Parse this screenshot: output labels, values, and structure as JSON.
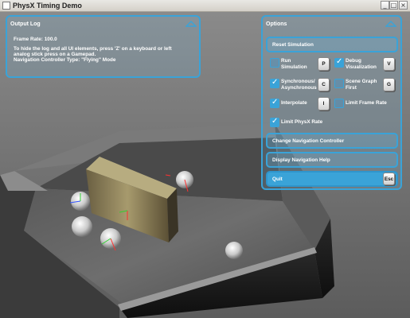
{
  "window": {
    "title": "PhysX Timing Demo",
    "min": "_",
    "max": "□",
    "close": "×"
  },
  "output_log": {
    "title": "Output Log",
    "lines": [
      "Frame Rate: 100.0",
      "To hide the log and all UI elements, press 'Z' on a keyboard or left",
      "analog stick press on a Gamepad.",
      "Navigation Controller Type: \"Flying\" Mode"
    ]
  },
  "options": {
    "title": "Options",
    "reset_label": "Reset Simulation",
    "checkboxes": [
      {
        "label": "Run Simulation",
        "checked": false,
        "key": "P"
      },
      {
        "label": "Debug Visualization",
        "checked": true,
        "key": "V"
      },
      {
        "label": "Synchronous/ Asynchronous",
        "checked": true,
        "key": "C"
      },
      {
        "label": "Scene Graph First",
        "checked": false,
        "key": "G"
      },
      {
        "label": "Interpolate",
        "checked": true,
        "key": "I"
      },
      {
        "label": "Limit Frame Rate",
        "checked": false,
        "key": ""
      },
      {
        "label": "Limit PhysX Rate",
        "checked": true,
        "key": ""
      }
    ],
    "change_nav_label": "Change Navigation Controller",
    "nav_help_label": "Display Navigation Help",
    "quit_label": "Quit",
    "quit_key": "Esc"
  },
  "colors": {
    "accent": "#3aa3d8",
    "panel_border": "#3aa3d8",
    "quit_fill": "#3aa3d8"
  }
}
